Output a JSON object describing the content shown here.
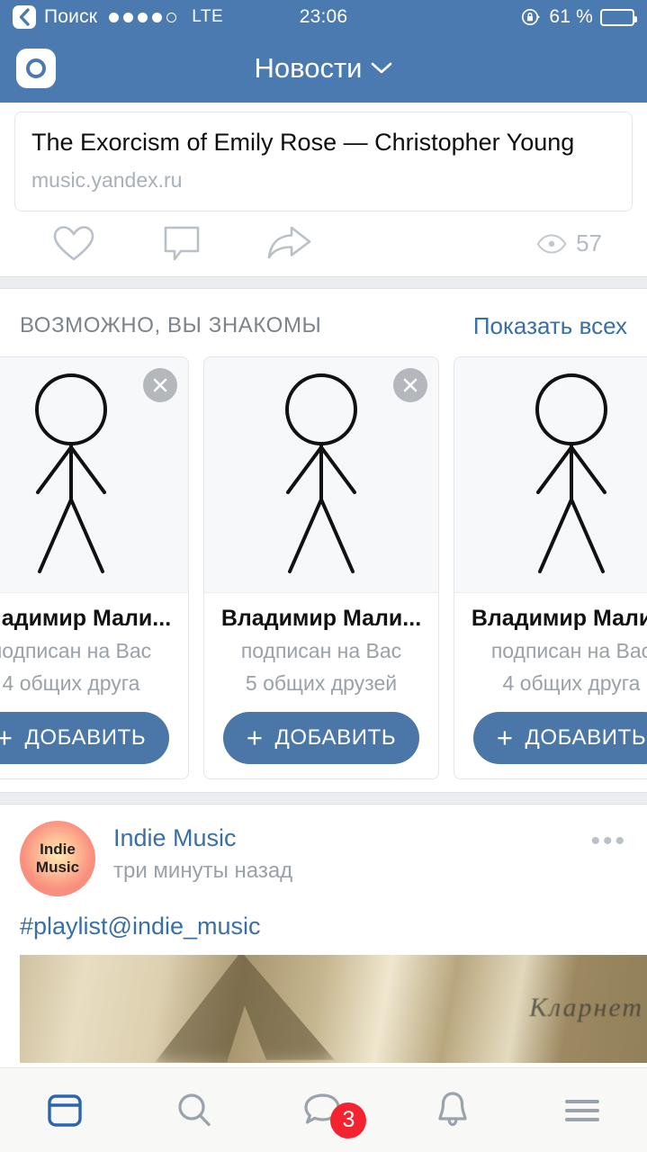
{
  "statusbar": {
    "back_label": "Поиск",
    "back_icon": "chevron-left-icon",
    "signal_dots_filled": 4,
    "signal_dots_total": 5,
    "network": "LTE",
    "time": "23:06",
    "rotation_lock_icon": "rotation-lock-icon",
    "battery_percent": "61 %",
    "battery_level": 61
  },
  "navbar": {
    "story_icon": "camera-circle-icon",
    "title": "Новости",
    "chevron": "⌄"
  },
  "post_link": {
    "title": "The Exorcism of Emily Rose — Christopher Young",
    "domain": "music.yandex.ru",
    "actions": {
      "like_icon": "heart-icon",
      "comment_icon": "comment-bubble-icon",
      "share_icon": "share-arrow-icon",
      "views_icon": "eye-icon",
      "views_count": "57"
    }
  },
  "suggestions": {
    "title": "ВОЗМОЖНО, ВЫ ЗНАКОМЫ",
    "show_all": "Показать всех",
    "close_icon": "close-icon",
    "add_plus": "+",
    "add_label": "ДОБАВИТЬ",
    "cards": [
      {
        "name": "Владимир Мали...",
        "relation": "подписан на Вас",
        "mutual": "4 общих друга",
        "avatar_icon": "stick-figure-avatar"
      },
      {
        "name": "Владимир Мали...",
        "relation": "подписан на Вас",
        "mutual": "5 общих друзей",
        "avatar_icon": "stick-figure-avatar"
      },
      {
        "name": "Владимир Мали...",
        "relation": "подписан на Вас",
        "mutual": "4 общих друга",
        "avatar_icon": "stick-figure-avatar"
      }
    ]
  },
  "post_music": {
    "avatar_line1": "Indie",
    "avatar_line2": "Music",
    "author": "Indie Music",
    "time": "три минуты назад",
    "more_icon": "more-dots-icon",
    "more_glyph": "•••",
    "text": "#playlist@indie_music",
    "photo_text": "Кларнет"
  },
  "tabbar": {
    "items": [
      {
        "icon": "news-feed-icon",
        "active": true,
        "badge": ""
      },
      {
        "icon": "search-icon",
        "active": false,
        "badge": ""
      },
      {
        "icon": "messages-icon",
        "active": false,
        "badge": "3"
      },
      {
        "icon": "bell-icon",
        "active": false,
        "badge": ""
      },
      {
        "icon": "hamburger-menu-icon",
        "active": false,
        "badge": ""
      }
    ]
  },
  "colors": {
    "header_blue": "#4a7ab0",
    "vk_blue": "#4a76a8",
    "link_blue": "#3a6fa5",
    "badge_red": "#f5232f",
    "muted_gray": "#9aa1a8"
  }
}
